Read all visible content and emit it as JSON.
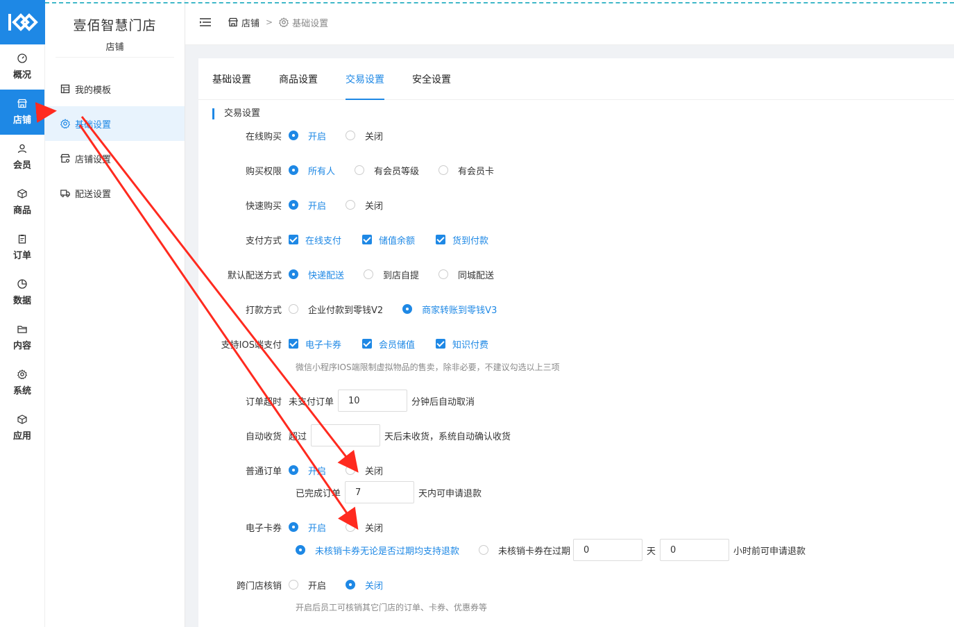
{
  "sidebar": {
    "items": [
      {
        "label": "概况",
        "icon": "dashboard-icon"
      },
      {
        "label": "店铺",
        "icon": "store-icon"
      },
      {
        "label": "会员",
        "icon": "user-icon"
      },
      {
        "label": "商品",
        "icon": "box-icon"
      },
      {
        "label": "订单",
        "icon": "clipboard-icon"
      },
      {
        "label": "数据",
        "icon": "pie-chart-icon"
      },
      {
        "label": "内容",
        "icon": "folder-icon"
      },
      {
        "label": "系统",
        "icon": "gear-icon"
      },
      {
        "label": "应用",
        "icon": "cube-icon"
      }
    ],
    "active": "店铺"
  },
  "submenu": {
    "store_name": "壹佰智慧门店",
    "store_sub": "店铺",
    "items": [
      {
        "label": "我的模板",
        "icon": "template-icon"
      },
      {
        "label": "基础设置",
        "icon": "gear-icon"
      },
      {
        "label": "店铺设置",
        "icon": "store-settings-icon"
      },
      {
        "label": "配送设置",
        "icon": "truck-icon"
      }
    ]
  },
  "header": {
    "crumb1": "店铺",
    "crumb_sep": ">",
    "crumb2": "基础设置"
  },
  "tabs": [
    "基础设置",
    "商品设置",
    "交易设置",
    "安全设置"
  ],
  "active_tab": "交易设置",
  "section_title": "交易设置",
  "form": {
    "online_buy": {
      "label": "在线购买",
      "options": [
        "开启",
        "关闭"
      ]
    },
    "buy_permission": {
      "label": "购买权限",
      "options": [
        "所有人",
        "有会员等级",
        "有会员卡"
      ]
    },
    "quick_buy": {
      "label": "快速购买",
      "options": [
        "开启",
        "关闭"
      ]
    },
    "payment": {
      "label": "支付方式",
      "options": [
        "在线支付",
        "储值余额",
        "货到付款"
      ]
    },
    "delivery": {
      "label": "默认配送方式",
      "options": [
        "快递配送",
        "到店自提",
        "同城配送"
      ]
    },
    "payout": {
      "label": "打款方式",
      "options": [
        "企业付款到零钱V2",
        "商家转账到零钱V3"
      ]
    },
    "ios_pay": {
      "label": "支持IOS端支付",
      "options": [
        "电子卡券",
        "会员储值",
        "知识付费"
      ],
      "hint": "微信小程序IOS端限制虚拟物品的售卖，除非必要，不建议勾选以上三项"
    },
    "order_timeout": {
      "label": "订单超时",
      "prefix": "未支付订单",
      "value": "10",
      "suffix": "分钟后自动取消"
    },
    "auto_receive": {
      "label": "自动收货",
      "prefix": "超过",
      "value": "",
      "suffix": "天后未收货，系统自动确认收货"
    },
    "normal_order": {
      "label": "普通订单",
      "options": [
        "开启",
        "关闭"
      ],
      "prefix": "已完成订单",
      "value": "7",
      "suffix": "天内可申请退款"
    },
    "ecard": {
      "label": "电子卡券",
      "options": [
        "开启",
        "关闭"
      ],
      "refund_opt1": "未核销卡券无论是否过期均支持退款",
      "refund_opt2": "未核销卡券在过期",
      "days_value": "0",
      "days_unit": "天",
      "hours_value": "0",
      "hours_suffix": "小时前可申请退款"
    },
    "cross_store": {
      "label": "跨门店核销",
      "options": [
        "开启",
        "关闭"
      ],
      "hint": "开启后员工可核销其它门店的订单、卡券、优惠券等"
    }
  },
  "colors": {
    "accent": "#1e88e5",
    "arrow": "#ff2a1f"
  }
}
